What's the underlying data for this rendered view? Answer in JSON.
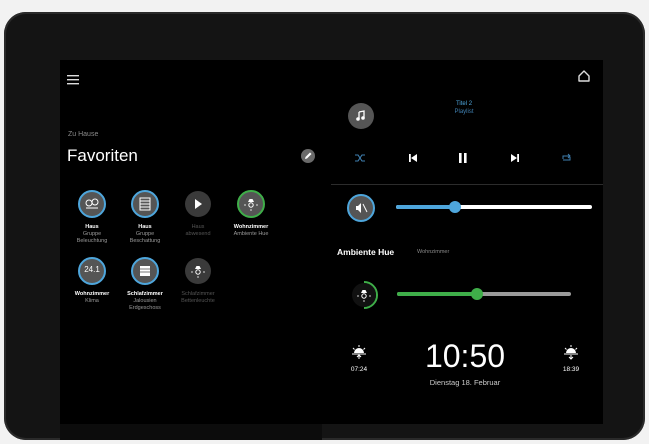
{
  "header": {
    "menu_icon": "hamburger-icon",
    "home_icon": "home-icon"
  },
  "favorites": {
    "section_label": "Zu Hause",
    "title": "Favoriten",
    "edit_icon": "pencil-icon",
    "items": [
      {
        "icon": "lightbulb-group-icon",
        "line1": "Haus",
        "line2": "Gruppe",
        "line3": "Beleuchtung",
        "active": true
      },
      {
        "icon": "blinds-group-icon",
        "line1": "Haus",
        "line2": "Gruppe",
        "line3": "Beschattung",
        "active": true
      },
      {
        "icon": "play-icon",
        "line1": "Haus",
        "line2": "abwesend",
        "line3": "",
        "active": false
      },
      {
        "icon": "lamp-icon",
        "line1": "Wohnzimmer",
        "line2": "Ambiente Hue",
        "line3": "",
        "active": true
      },
      {
        "icon": "thermostat-icon",
        "value": "24.1",
        "line1": "Wohnzimmer",
        "line2": "Klima",
        "line3": "",
        "active": true
      },
      {
        "icon": "blinds-icon",
        "line1": "Schlafzimmer",
        "line2": "Jalousien",
        "line3": "Erdgeschoss",
        "active": true
      },
      {
        "icon": "lamp-icon",
        "line1": "Schlafzimmer",
        "line2": "Bettenleuchte",
        "line3": "",
        "active": false
      }
    ]
  },
  "media": {
    "track_title": "Titel 2",
    "track_subtitle": "Playlist",
    "note_icon": "music-note-icon",
    "volume_icon": "speaker-icon",
    "volume_level": 0.3,
    "controls": [
      "shuffle-icon",
      "previous-icon",
      "pause-icon",
      "next-icon",
      "repeat-icon"
    ]
  },
  "light": {
    "name": "Ambiente Hue",
    "room": "Wohnzimmer",
    "icon": "lamp-icon",
    "brightness_level": 0.46
  },
  "clock": {
    "time": "10:50",
    "date": "Dienstag 18. Februar",
    "sunrise": "07:24",
    "sunset": "18:39",
    "sunrise_icon": "sunrise-icon",
    "sunset_icon": "sunset-icon"
  },
  "colors": {
    "accent_blue": "#4ea6dc",
    "accent_green": "#3fae49",
    "track_grey": "#9a9a9a"
  }
}
